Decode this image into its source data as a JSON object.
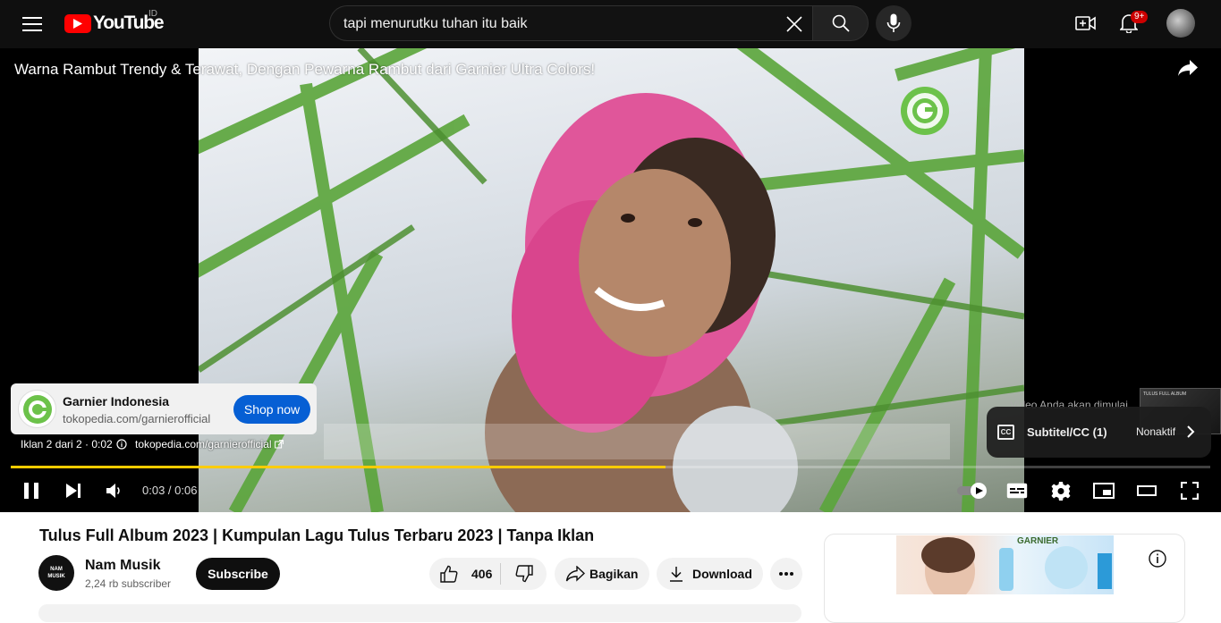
{
  "topbar": {
    "logo_text": "YouTube",
    "country_code": "ID",
    "search_value": "tapi menurutku tuhan itu baik",
    "notifications_badge": "9+"
  },
  "player": {
    "ad_title": "Warna Rambut Trendy & Terawat, Dengan Pewarna Rambut dari Garnier Ultra Colors!",
    "ad_card": {
      "advertiser": "Garnier Indonesia",
      "url": "tokopedia.com/garnierofficial",
      "cta": "Shop now"
    },
    "ad_info": "Iklan 2 dari 2 · 0:02",
    "ad_link": "tokopedia.com/garnierofficial",
    "next_video_label": "Video Anda akan dimulai",
    "next_thumb_text": "TULUS FULL ALBUM",
    "captions_panel": {
      "icon": "CC",
      "label": "Subtitel/CC (1)",
      "value": "Nonaktif"
    },
    "time": "0:03 / 0:06",
    "progress_fraction": 0.546
  },
  "video": {
    "title": "Tulus Full Album 2023 | Kumpulan Lagu Tulus Terbaru 2023 | Tanpa Iklan",
    "channel_name": "Nam Musik",
    "channel_avatar_text": "NAM MUSIK",
    "subscribers": "2,24 rb subscriber",
    "subscribe_label": "Subscribe",
    "likes": "406",
    "share_label": "Bagikan",
    "download_label": "Download"
  },
  "side_ad": {
    "brand": "GARNIER"
  },
  "colors": {
    "brand_red": "#ff0000",
    "progress": "#ffcc00",
    "cta_blue": "#065fd4",
    "garnier_green": "#6cc24a"
  }
}
